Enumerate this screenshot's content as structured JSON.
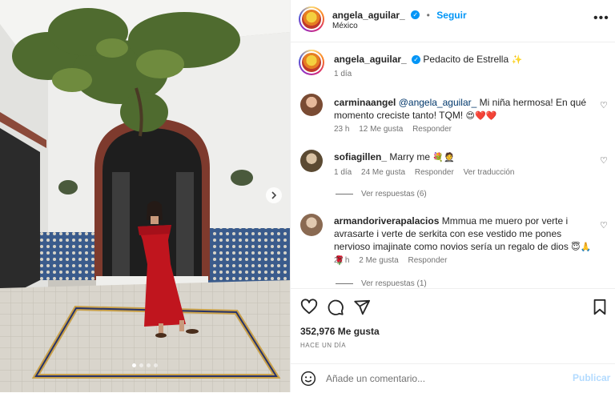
{
  "post": {
    "author": "angela_aguilar_",
    "follow_label": "Seguir",
    "location": "México",
    "more_label": "•••",
    "caption": "Pedacito de Estrella",
    "caption_emoji": "✨",
    "caption_time": "1 día",
    "likes": "352,976 Me gusta",
    "date": "HACE UN DÍA",
    "carousel_dots": 4
  },
  "comments": [
    {
      "user": "carminaangel",
      "mention": "@angela_aguilar_",
      "text": "Mi niña hermosa! En qué momento creciste tanto! TQM!",
      "emoji": "😍❤️❤️",
      "time": "23 h",
      "likes": "12 Me gusta",
      "reply": "Responder"
    },
    {
      "user": "sofiagillen_",
      "text": "Marry me",
      "emoji": "💐🤵",
      "time": "1 día",
      "likes": "24 Me gusta",
      "reply": "Responder",
      "translate": "Ver traducción",
      "view_replies": "Ver respuestas (6)"
    },
    {
      "user": "armandoriverapalacios",
      "text": "Mmmua me muero por verte i avrasarte i verte de serkita con ese vestido me pones nervioso imajinate como novios sería un regalo de dios",
      "emoji": "😇🙏🌹",
      "time": "22 h",
      "likes": "2 Me gusta",
      "reply": "Responder",
      "view_replies": "Ver respuestas (1)"
    }
  ],
  "composer": {
    "placeholder": "Añade un comentario...",
    "publish_label": "Publicar"
  },
  "icons": {
    "heart": "heart-icon",
    "comment": "comment-icon",
    "share": "share-icon",
    "save": "bookmark-icon",
    "emoji": "emoji-icon",
    "next": "chevron-right-icon"
  },
  "colors": {
    "accent": "#0095f6",
    "publish_disabled": "#b3dbff",
    "dress": "#c0151e"
  }
}
